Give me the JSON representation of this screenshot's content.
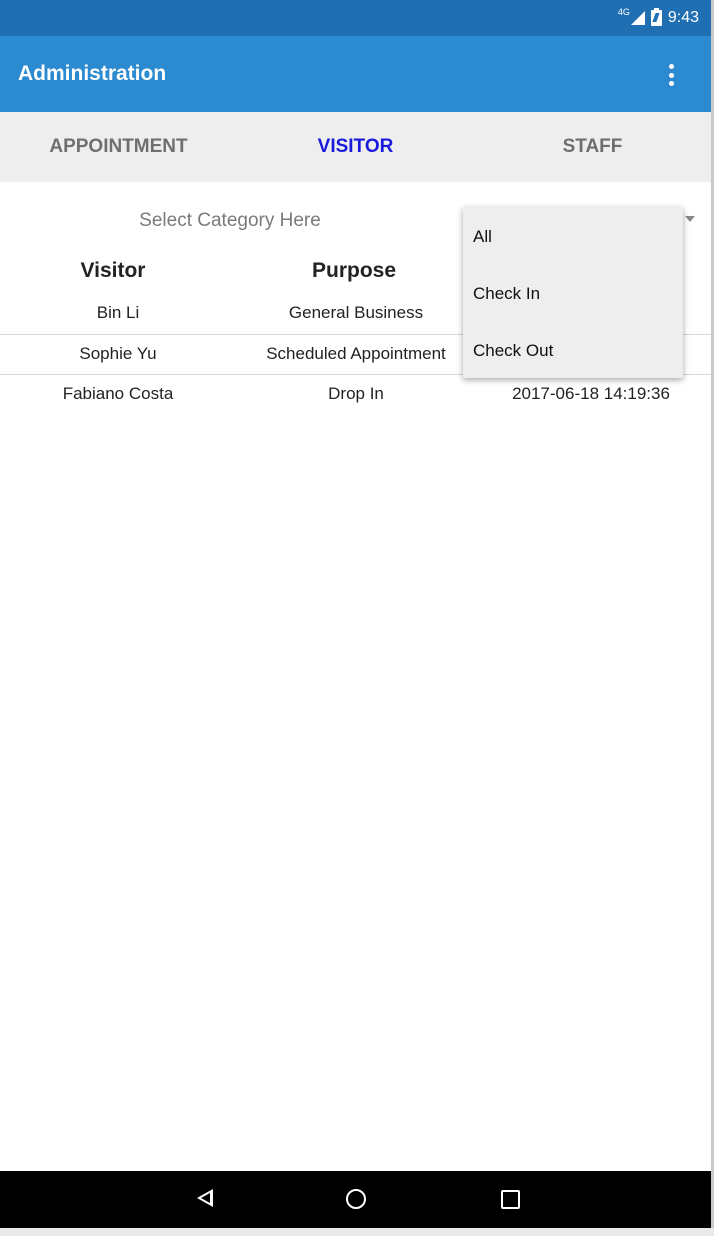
{
  "status_bar": {
    "network": "4G",
    "time": "9:43",
    "icons": [
      "signal-icon",
      "battery-icon"
    ],
    "color": "#1f6fb2"
  },
  "app_bar": {
    "title": "Administration",
    "menu_icon": "overflow-menu-icon",
    "color": "#2b8ad0"
  },
  "tabs": [
    {
      "label": "APPOINTMENT",
      "active": false
    },
    {
      "label": "VISITOR",
      "active": true
    },
    {
      "label": "STAFF",
      "active": false
    }
  ],
  "category": {
    "label": "Select Category Here"
  },
  "table": {
    "headers": {
      "visitor": "Visitor",
      "purpose": "Purpose"
    },
    "rows": [
      {
        "visitor": "Bin Li",
        "purpose": "General Business",
        "time": ""
      },
      {
        "visitor": "Sophie Yu",
        "purpose": "Scheduled Appointment",
        "time": ""
      },
      {
        "visitor": "Fabiano Costa",
        "purpose": "Drop In",
        "time": "2017-06-18 14:19:36"
      }
    ]
  },
  "dropdown": {
    "options": [
      "All",
      "Check In",
      "Check Out"
    ]
  },
  "nav_bar": {
    "icons": [
      "back-icon",
      "home-icon",
      "recents-icon"
    ]
  },
  "colors": {
    "active_tab": "#1a1add",
    "inactive_tab": "#6f6f6f"
  }
}
